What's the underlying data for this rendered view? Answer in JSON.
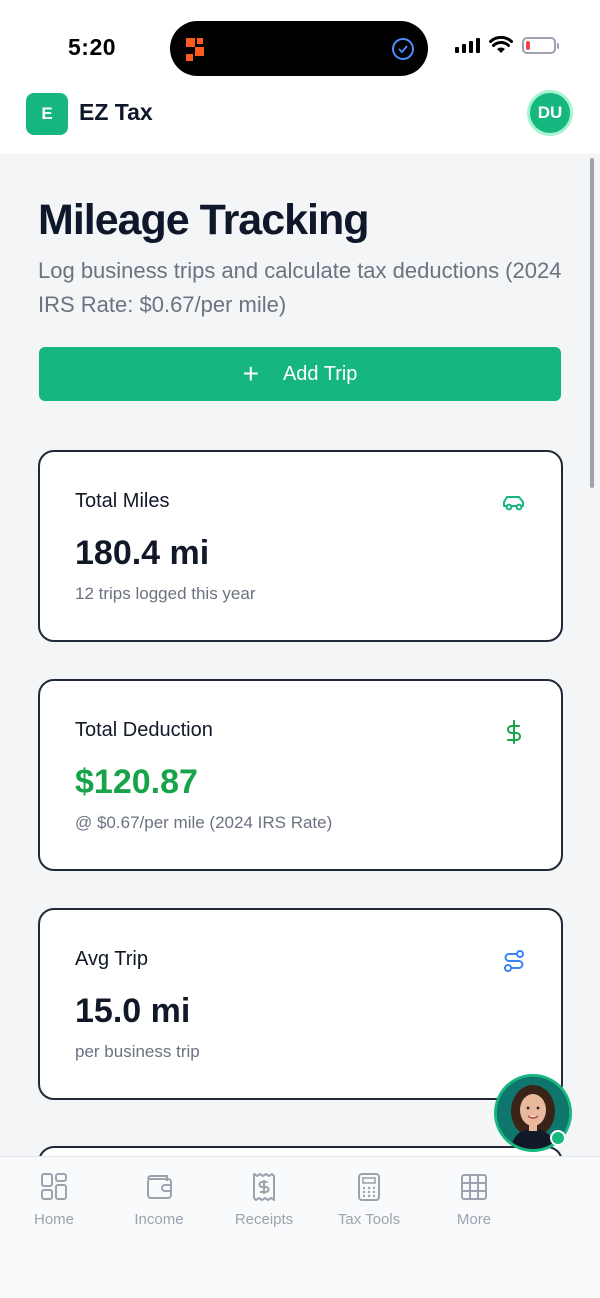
{
  "status_bar": {
    "time": "5:20"
  },
  "header": {
    "logo_letter": "E",
    "app_name": "EZ Tax",
    "user_initials": "DU"
  },
  "page": {
    "title": "Mileage Tracking",
    "subtitle": "Log business trips and calculate tax deductions (2024 IRS Rate: $0.67/per mile)",
    "add_button": {
      "icon": "plus-icon",
      "label": "Add Trip"
    }
  },
  "cards": [
    {
      "label": "Total Miles",
      "value": "180.4 mi",
      "sub": "12 trips logged this year",
      "icon": "car-icon"
    },
    {
      "label": "Total Deduction",
      "value": "$120.87",
      "sub": "@ $0.67/per mile (2024 IRS Rate)",
      "icon": "dollar-icon"
    },
    {
      "label": "Avg Trip",
      "value": "15.0 mi",
      "sub": "per business trip",
      "icon": "route-icon"
    }
  ],
  "colors": {
    "accent": "#16b77e",
    "value_green": "#16a34a",
    "icon_blue": "#3b82f6"
  },
  "nav": [
    {
      "label": "Home",
      "icon": "grid-icon"
    },
    {
      "label": "Income",
      "icon": "wallet-icon"
    },
    {
      "label": "Receipts",
      "icon": "receipt-icon"
    },
    {
      "label": "Tax Tools",
      "icon": "calculator-icon"
    },
    {
      "label": "More",
      "icon": "apps-icon"
    }
  ]
}
